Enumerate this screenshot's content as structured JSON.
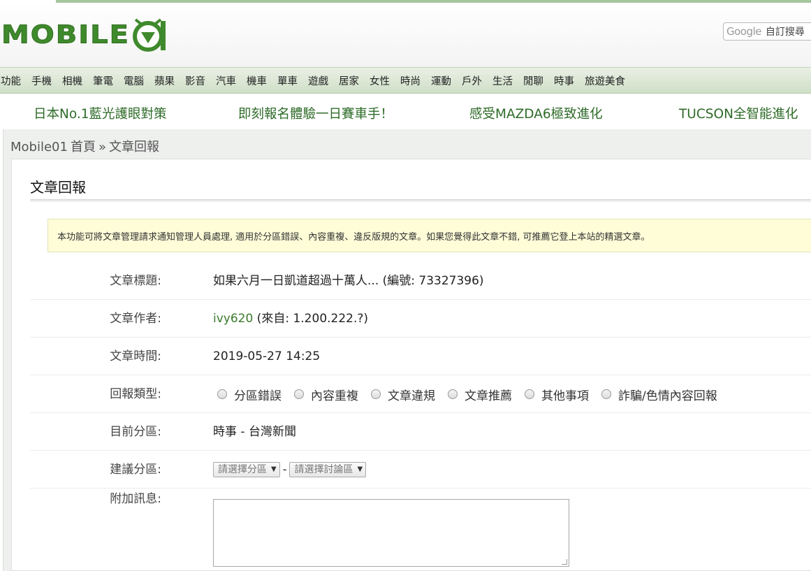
{
  "header": {
    "logo_text": "MOBILE",
    "logo_badge": "01",
    "search_google": "Google",
    "search_label": "自訂搜尋"
  },
  "nav": {
    "items": [
      "功能",
      "手機",
      "相機",
      "筆電",
      "電腦",
      "蘋果",
      "影音",
      "汽車",
      "機車",
      "單車",
      "遊戲",
      "居家",
      "女性",
      "時尚",
      "運動",
      "戶外",
      "生活",
      "閒聊",
      "時事",
      "旅遊美食"
    ]
  },
  "promos": [
    "日本No.1藍光護眼對策",
    "即刻報名體驗一日賽車手！",
    "感受MAZDA6極致進化",
    "TUCSON全智能進化"
  ],
  "breadcrumb": {
    "site": "Mobile01",
    "home": "首頁",
    "sep": "»",
    "current": "文章回報"
  },
  "panel": {
    "title": "文章回報",
    "notice": "本功能可將文章管理請求通知管理人員處理, 適用於分區錯誤、內容重複、違反版規的文章。如果您覺得此文章不錯, 可推薦它登上本站的精選文章。"
  },
  "form": {
    "title_label": "文章標題:",
    "title_value": "如果六月一日凱道超過十萬人... (編號: 73327396)",
    "author_label": "文章作者:",
    "author_name": "ivy620",
    "author_from": " (來自: 1.200.222.?)",
    "time_label": "文章時間:",
    "time_value": "2019-05-27 14:25",
    "type_label": "回報類型:",
    "type_options": [
      "分區錯誤",
      "內容重複",
      "文章違規",
      "文章推薦",
      "其他事項",
      "詐騙/色情內容回報"
    ],
    "section_label": "目前分區:",
    "section_value": "時事 - 台灣新聞",
    "suggest_label": "建議分區:",
    "select_forum": "請選擇分區",
    "select_board": "請選擇討論區",
    "suggest_dash": "-",
    "message_label": "附加訊息:",
    "message_value": ""
  },
  "colors": {
    "brand_green": "#3f8a2c",
    "link_green": "#3a7a2c",
    "notice_bg": "#fefdd8"
  }
}
